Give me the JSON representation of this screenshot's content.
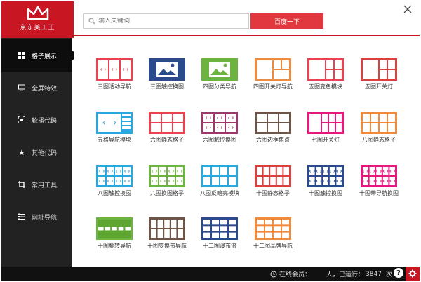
{
  "app": {
    "logo_text": "京东美工王",
    "brand_color": "#c81623"
  },
  "search": {
    "placeholder": "输入关键词",
    "button_label": "百度一下"
  },
  "sidebar": {
    "items": [
      {
        "label": "格子展示",
        "icon": "grid-icon",
        "active": true
      },
      {
        "label": "全屏特效",
        "icon": "monitor-icon"
      },
      {
        "label": "轮播代码",
        "icon": "expand-icon"
      },
      {
        "label": "其他代码",
        "icon": "star-icon"
      },
      {
        "label": "常用工具",
        "icon": "crop-icon"
      },
      {
        "label": "网址导航",
        "icon": "list-icon"
      }
    ]
  },
  "tiles": [
    {
      "label": "三图活动导航",
      "color": "#e8434f",
      "pattern": "tri-arrows"
    },
    {
      "label": "三图触控换图",
      "color": "#2b4a8c",
      "pattern": "image"
    },
    {
      "label": "四图分类导航",
      "color": "#6db33f",
      "pattern": "image"
    },
    {
      "label": "四图开关灯导航",
      "color": "#f08a3c",
      "pattern": "quad"
    },
    {
      "label": "五图变色模块",
      "color": "#e8434f",
      "pattern": "five"
    },
    {
      "label": "五图开关灯",
      "color": "#d94040",
      "pattern": "five"
    },
    {
      "label": "五格导航模块",
      "color": "#29a8df",
      "pattern": "nav5"
    },
    {
      "label": "六图静态格子",
      "color": "#e8434f",
      "pattern": "six"
    },
    {
      "label": "六图触控换图",
      "color": "#9b3a6a",
      "pattern": "six-arrows"
    },
    {
      "label": "六图边框焦点",
      "color": "#6e5547",
      "pattern": "six"
    },
    {
      "label": "七图开关灯",
      "color": "#e6177d",
      "pattern": "seven"
    },
    {
      "label": "八图静态格子",
      "color": "#f08a3c",
      "pattern": "eight"
    },
    {
      "label": "八图触控换图",
      "color": "#29a8df",
      "pattern": "eight-arrows"
    },
    {
      "label": "八图换图格子",
      "color": "#6db33f",
      "pattern": "eight-arrows"
    },
    {
      "label": "八图反暗亮模块",
      "color": "#29a8df",
      "pattern": "eight"
    },
    {
      "label": "十图静态格子",
      "color": "#d94040",
      "pattern": "ten"
    },
    {
      "label": "十图触控换图",
      "color": "#2b4a8c",
      "pattern": "ten-arrows"
    },
    {
      "label": "十图带导航换图",
      "color": "#e6177d",
      "pattern": "ten-arrows"
    },
    {
      "label": "十图翻转导航",
      "color": "#6db33f",
      "pattern": "flip"
    },
    {
      "label": "十图变换带导航",
      "color": "#6e5547",
      "pattern": "ten"
    },
    {
      "label": "十二图瀑布流",
      "color": "#2b4a8c",
      "pattern": "twelve"
    },
    {
      "label": "十二图品牌导航",
      "color": "#f08a3c",
      "pattern": "twelve"
    }
  ],
  "status": {
    "members_label": "在线会员：",
    "members_unit": "人，已运行：",
    "runs": "3847",
    "runs_unit": "次"
  }
}
